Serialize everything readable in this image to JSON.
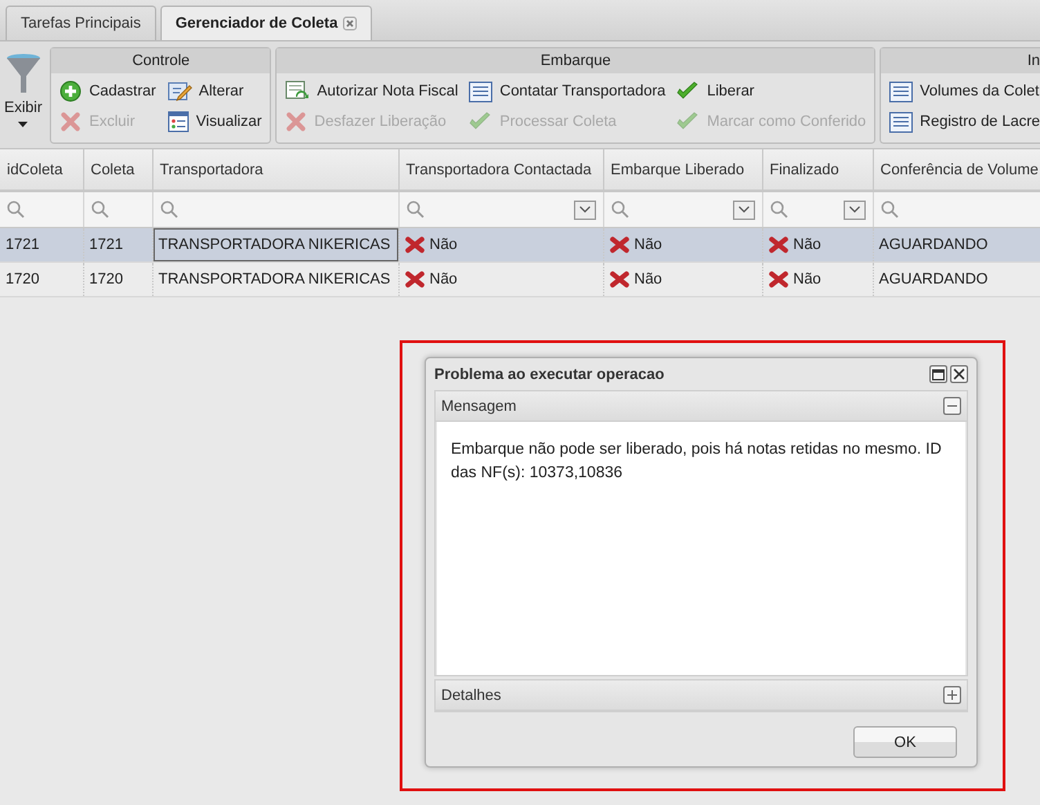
{
  "tabs": [
    {
      "label": "Tarefas Principais",
      "selected": false,
      "closable": false
    },
    {
      "label": "Gerenciador de Coleta",
      "selected": true,
      "closable": true
    }
  ],
  "toolbar": {
    "view_button": {
      "label": "Exibir"
    },
    "groups": [
      {
        "title": "Controle",
        "actions": [
          {
            "label": "Cadastrar",
            "kind": "add",
            "disabled": false
          },
          {
            "label": "Excluir",
            "kind": "delete",
            "disabled": true
          },
          {
            "label": "Alterar",
            "kind": "edit",
            "disabled": false
          },
          {
            "label": "Visualizar",
            "kind": "view",
            "disabled": false
          }
        ]
      },
      {
        "title": "Embarque",
        "actions": [
          {
            "label": "Autorizar Nota Fiscal",
            "kind": "authorize",
            "disabled": false
          },
          {
            "label": "Desfazer Liberação",
            "kind": "delete",
            "disabled": true
          },
          {
            "label": "Contatar Transportadora",
            "kind": "list",
            "disabled": false
          },
          {
            "label": "Processar Coleta",
            "kind": "check",
            "disabled": true
          },
          {
            "label": "Liberar",
            "kind": "check",
            "disabled": false
          },
          {
            "label": "Marcar como Conferido",
            "kind": "check",
            "disabled": true
          }
        ]
      },
      {
        "title": "In",
        "actions": [
          {
            "label": "Volumes da Colet",
            "kind": "list",
            "disabled": false
          },
          {
            "label": "Registro de Lacre",
            "kind": "list",
            "disabled": false
          }
        ]
      }
    ]
  },
  "grid": {
    "columns": [
      {
        "label": "idColeta",
        "dropdown": false
      },
      {
        "label": "Coleta",
        "dropdown": false
      },
      {
        "label": "Transportadora",
        "dropdown": false
      },
      {
        "label": "Transportadora Contactada",
        "dropdown": true
      },
      {
        "label": "Embarque Liberado",
        "dropdown": true
      },
      {
        "label": "Finalizado",
        "dropdown": true
      },
      {
        "label": "Conferência de Volume",
        "dropdown": false
      }
    ],
    "rows": [
      {
        "selected": true,
        "cells": [
          {
            "kind": "text",
            "text": "1721",
            "focused": false
          },
          {
            "kind": "text",
            "text": "1721",
            "focused": false
          },
          {
            "kind": "text",
            "text": "TRANSPORTADORA NIKERICAS",
            "focused": true
          },
          {
            "kind": "status",
            "text": "Não",
            "value": false,
            "focused": false
          },
          {
            "kind": "status",
            "text": "Não",
            "value": false,
            "focused": false
          },
          {
            "kind": "status",
            "text": "Não",
            "value": false,
            "focused": false
          },
          {
            "kind": "text",
            "text": "AGUARDANDO",
            "focused": false
          }
        ]
      },
      {
        "selected": false,
        "cells": [
          {
            "kind": "text",
            "text": "1720",
            "focused": false
          },
          {
            "kind": "text",
            "text": "1720",
            "focused": false
          },
          {
            "kind": "text",
            "text": "TRANSPORTADORA NIKERICAS",
            "focused": false
          },
          {
            "kind": "status",
            "text": "Não",
            "value": false,
            "focused": false
          },
          {
            "kind": "status",
            "text": "Não",
            "value": false,
            "focused": false
          },
          {
            "kind": "status",
            "text": "Não",
            "value": false,
            "focused": false
          },
          {
            "kind": "text",
            "text": "AGUARDANDO",
            "focused": false
          }
        ]
      }
    ]
  },
  "dialog": {
    "title": "Problema ao executar operacao",
    "highlighted": true,
    "panels": [
      {
        "title": "Mensagem",
        "expanded": true,
        "text": "Embarque não pode ser liberado, pois há notas retidas no mesmo. ID das NF(s): 10373,10836"
      },
      {
        "title": "Detalhes",
        "expanded": false
      }
    ],
    "button": "OK"
  }
}
